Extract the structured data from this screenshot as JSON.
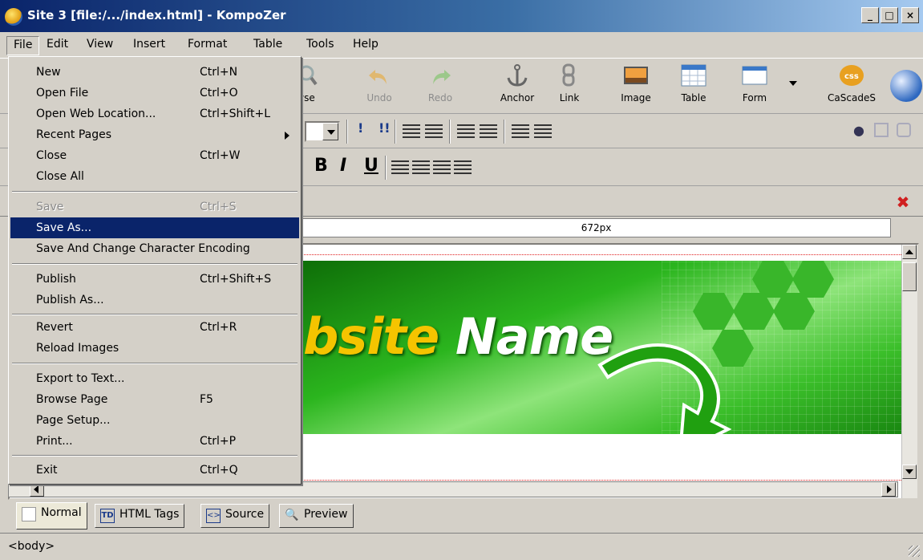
{
  "window": {
    "title": "Site 3 [file:/.../index.html] - KompoZer",
    "controls": {
      "minimize": "_",
      "maximize": "□",
      "close": "×"
    }
  },
  "menubar": [
    "File",
    "Edit",
    "View",
    "Insert",
    "Format",
    "Table",
    "Tools",
    "Help"
  ],
  "toolbar": {
    "browse": "wse",
    "undo": "Undo",
    "redo": "Redo",
    "anchor": "Anchor",
    "link": "Link",
    "image": "Image",
    "table": "Table",
    "form": "Form",
    "cascades": "CaScadeS"
  },
  "format_toolbar": {
    "bold": "B",
    "italic": "I",
    "underline": "U"
  },
  "ruler": {
    "width_label": "672px"
  },
  "banner": {
    "text_yellow": "bsite",
    "text_white": " Name"
  },
  "view_tabs": [
    "Normal",
    "HTML Tags",
    "Source",
    "Preview"
  ],
  "view_tab_icons": {
    "html_tags": "TD",
    "source": "<>"
  },
  "status": {
    "path": "<body>"
  },
  "file_menu": {
    "items": [
      {
        "label": "New",
        "shortcut": "Ctrl+N"
      },
      {
        "label": "Open File",
        "shortcut": "Ctrl+O"
      },
      {
        "label": "Open Web Location...",
        "shortcut": "Ctrl+Shift+L"
      },
      {
        "label": "Recent Pages",
        "shortcut": ""
      },
      {
        "label": "Close",
        "shortcut": "Ctrl+W"
      },
      {
        "label": "Close All",
        "shortcut": ""
      },
      {
        "label": "Save",
        "shortcut": "Ctrl+S"
      },
      {
        "label": "Save As...",
        "shortcut": ""
      },
      {
        "label": "Save And Change Character Encoding",
        "shortcut": ""
      },
      {
        "label": "Publish",
        "shortcut": "Ctrl+Shift+S"
      },
      {
        "label": "Publish As...",
        "shortcut": ""
      },
      {
        "label": "Revert",
        "shortcut": "Ctrl+R"
      },
      {
        "label": "Reload Images",
        "shortcut": ""
      },
      {
        "label": "Export to Text...",
        "shortcut": ""
      },
      {
        "label": "Browse Page",
        "shortcut": "F5"
      },
      {
        "label": "Page Setup...",
        "shortcut": ""
      },
      {
        "label": "Print...",
        "shortcut": "Ctrl+P"
      },
      {
        "label": "Exit",
        "shortcut": "Ctrl+Q"
      }
    ]
  },
  "colors": {
    "title_bar": "#0a246a",
    "menu_highlight": "#0a246a",
    "banner_green": "#2bb51e",
    "banner_yellow": "#f5c400"
  }
}
